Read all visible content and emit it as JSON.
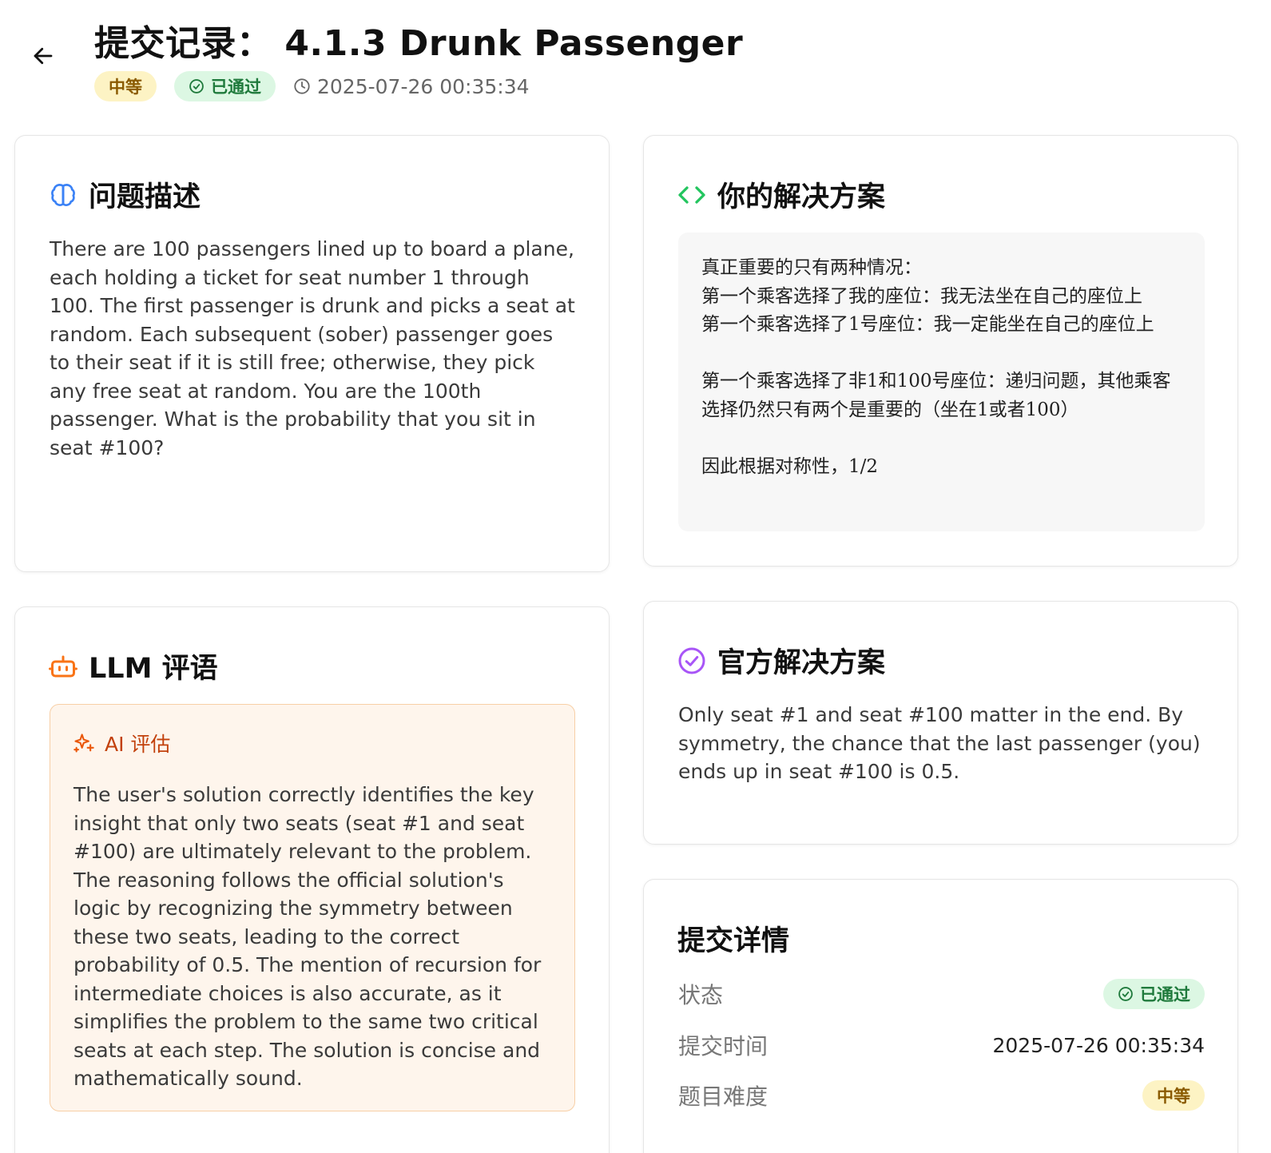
{
  "header": {
    "title": "提交记录： 4.1.3 Drunk Passenger",
    "difficulty_badge": "中等",
    "status_badge": "已通过",
    "timestamp": "2025-07-26 00:35:34"
  },
  "problem_card": {
    "title": "问题描述",
    "text": "There are 100 passengers lined up to board a plane, each holding a ticket for seat number 1 through 100. The first passenger is drunk and picks a seat at random. Each subsequent (sober) passenger goes to their seat if it is still free; otherwise, they pick any free seat at random. You are the 100th passenger. What is the probability that you sit in seat #100?"
  },
  "solution_card": {
    "title": "你的解决方案",
    "lines": [
      "真正重要的只有两种情况：",
      "第一个乘客选择了我的座位：我无法坐在自己的座位上",
      "第一个乘客选择了1号座位：我一定能坐在自己的座位上",
      "",
      "第一个乘客选择了非1和100号座位：递归问题，其他乘客选择仍然只有两个是重要的（坐在1或者100）",
      "",
      "因此根据对称性，1/2"
    ]
  },
  "llm_card": {
    "title": "LLM 评语",
    "ai_label": "AI 评估",
    "text": "The user's solution correctly identifies the key insight that only two seats (seat #1 and seat #100) are ultimately relevant to the problem. The reasoning follows the official solution's logic by recognizing the symmetry between these two seats, leading to the correct probability of 0.5. The mention of recursion for intermediate choices is also accurate, as it simplifies the problem to the same two critical seats at each step. The solution is concise and mathematically sound."
  },
  "official_card": {
    "title": "官方解决方案",
    "text": "Only seat #1 and seat #100 matter in the end. By symmetry, the chance that the last passenger (you) ends up in seat #100 is 0.5."
  },
  "details_card": {
    "title": "提交详情",
    "status_label": "状态",
    "status_value": "已通过",
    "time_label": "提交时间",
    "time_value": "2025-07-26 00:35:34",
    "difficulty_label": "题目难度",
    "difficulty_value": "中等"
  },
  "colors": {
    "brain_icon": "#3b82f6",
    "code_icon": "#22c55e",
    "bot_icon": "#f97316",
    "check_icon": "#a855f7",
    "medium_bg": "#fdf3c4",
    "pass_bg": "#dcf7e3"
  },
  "icons": [
    "arrow-left-icon",
    "check-circle-icon",
    "clock-icon",
    "brain-icon",
    "code-icon",
    "bot-icon",
    "sparkles-icon",
    "circle-check-icon"
  ]
}
